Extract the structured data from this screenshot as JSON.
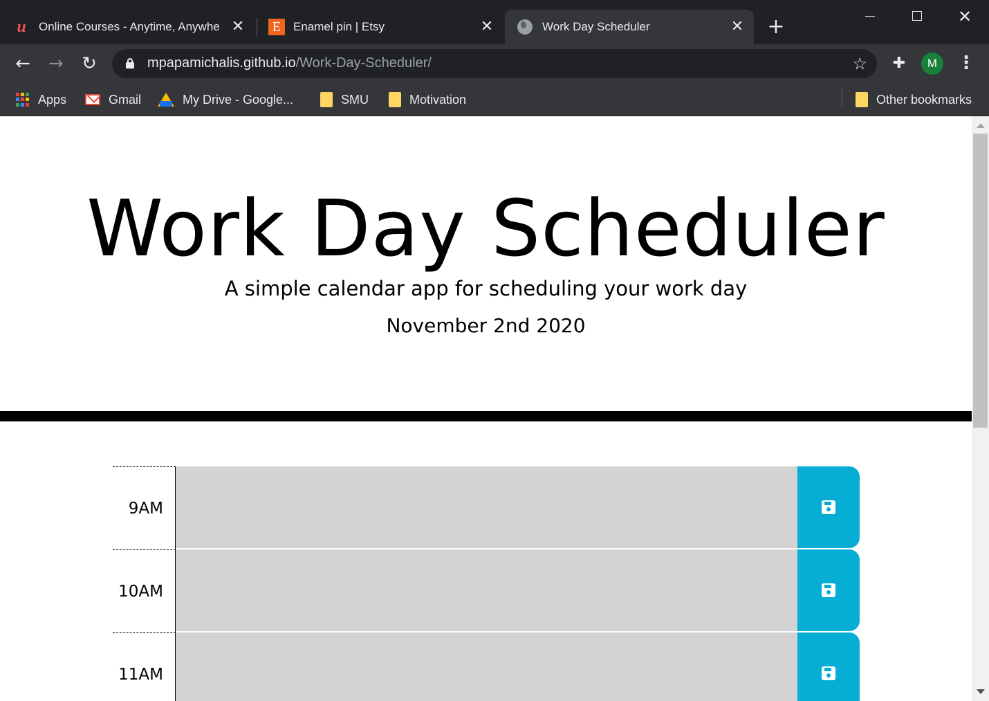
{
  "browser": {
    "tabs": [
      {
        "title": "Online Courses - Anytime, Anywhere",
        "favicon": "udemy-logo-icon",
        "favicon_glyph": "u",
        "active": false
      },
      {
        "title": "Enamel pin | Etsy",
        "favicon": "etsy-logo-icon",
        "favicon_glyph": "E",
        "active": false
      },
      {
        "title": "Work Day Scheduler",
        "favicon": "globe-icon",
        "active": true
      }
    ],
    "address": {
      "host": "mpapamichalis.github.io",
      "path": "/Work-Day-Scheduler/"
    },
    "profile_initial": "M",
    "bookmarks": [
      {
        "label": "Apps",
        "icon": "apps-grid-icon"
      },
      {
        "label": "Gmail",
        "icon": "gmail-icon"
      },
      {
        "label": "My Drive - Google...",
        "icon": "google-drive-icon"
      },
      {
        "label": "SMU",
        "icon": "folder-icon"
      },
      {
        "label": "Motivation",
        "icon": "folder-icon"
      }
    ],
    "other_bookmarks": "Other bookmarks"
  },
  "page": {
    "title": "Work Day Scheduler",
    "subtitle": "A simple calendar app for scheduling your work day",
    "current_day": "November 2nd 2020",
    "colors": {
      "past_block": "#d3d3d3",
      "save_button": "#06aed5",
      "divider": "#000000"
    },
    "time_blocks": [
      {
        "hour": "9AM",
        "description": ""
      },
      {
        "hour": "10AM",
        "description": ""
      },
      {
        "hour": "11AM",
        "description": ""
      }
    ]
  }
}
